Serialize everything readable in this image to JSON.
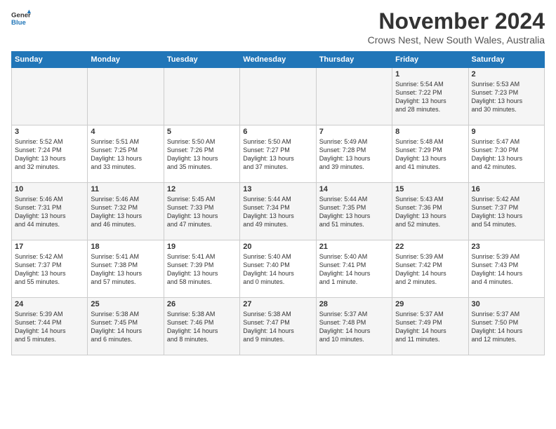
{
  "header": {
    "logo": {
      "general": "General",
      "blue": "Blue"
    },
    "title": "November 2024",
    "subtitle": "Crows Nest, New South Wales, Australia"
  },
  "weekdays": [
    "Sunday",
    "Monday",
    "Tuesday",
    "Wednesday",
    "Thursday",
    "Friday",
    "Saturday"
  ],
  "weeks": [
    [
      {
        "day": "",
        "detail": ""
      },
      {
        "day": "",
        "detail": ""
      },
      {
        "day": "",
        "detail": ""
      },
      {
        "day": "",
        "detail": ""
      },
      {
        "day": "",
        "detail": ""
      },
      {
        "day": "1",
        "detail": "Sunrise: 5:54 AM\nSunset: 7:22 PM\nDaylight: 13 hours\nand 28 minutes."
      },
      {
        "day": "2",
        "detail": "Sunrise: 5:53 AM\nSunset: 7:23 PM\nDaylight: 13 hours\nand 30 minutes."
      }
    ],
    [
      {
        "day": "3",
        "detail": "Sunrise: 5:52 AM\nSunset: 7:24 PM\nDaylight: 13 hours\nand 32 minutes."
      },
      {
        "day": "4",
        "detail": "Sunrise: 5:51 AM\nSunset: 7:25 PM\nDaylight: 13 hours\nand 33 minutes."
      },
      {
        "day": "5",
        "detail": "Sunrise: 5:50 AM\nSunset: 7:26 PM\nDaylight: 13 hours\nand 35 minutes."
      },
      {
        "day": "6",
        "detail": "Sunrise: 5:50 AM\nSunset: 7:27 PM\nDaylight: 13 hours\nand 37 minutes."
      },
      {
        "day": "7",
        "detail": "Sunrise: 5:49 AM\nSunset: 7:28 PM\nDaylight: 13 hours\nand 39 minutes."
      },
      {
        "day": "8",
        "detail": "Sunrise: 5:48 AM\nSunset: 7:29 PM\nDaylight: 13 hours\nand 41 minutes."
      },
      {
        "day": "9",
        "detail": "Sunrise: 5:47 AM\nSunset: 7:30 PM\nDaylight: 13 hours\nand 42 minutes."
      }
    ],
    [
      {
        "day": "10",
        "detail": "Sunrise: 5:46 AM\nSunset: 7:31 PM\nDaylight: 13 hours\nand 44 minutes."
      },
      {
        "day": "11",
        "detail": "Sunrise: 5:46 AM\nSunset: 7:32 PM\nDaylight: 13 hours\nand 46 minutes."
      },
      {
        "day": "12",
        "detail": "Sunrise: 5:45 AM\nSunset: 7:33 PM\nDaylight: 13 hours\nand 47 minutes."
      },
      {
        "day": "13",
        "detail": "Sunrise: 5:44 AM\nSunset: 7:34 PM\nDaylight: 13 hours\nand 49 minutes."
      },
      {
        "day": "14",
        "detail": "Sunrise: 5:44 AM\nSunset: 7:35 PM\nDaylight: 13 hours\nand 51 minutes."
      },
      {
        "day": "15",
        "detail": "Sunrise: 5:43 AM\nSunset: 7:36 PM\nDaylight: 13 hours\nand 52 minutes."
      },
      {
        "day": "16",
        "detail": "Sunrise: 5:42 AM\nSunset: 7:37 PM\nDaylight: 13 hours\nand 54 minutes."
      }
    ],
    [
      {
        "day": "17",
        "detail": "Sunrise: 5:42 AM\nSunset: 7:37 PM\nDaylight: 13 hours\nand 55 minutes."
      },
      {
        "day": "18",
        "detail": "Sunrise: 5:41 AM\nSunset: 7:38 PM\nDaylight: 13 hours\nand 57 minutes."
      },
      {
        "day": "19",
        "detail": "Sunrise: 5:41 AM\nSunset: 7:39 PM\nDaylight: 13 hours\nand 58 minutes."
      },
      {
        "day": "20",
        "detail": "Sunrise: 5:40 AM\nSunset: 7:40 PM\nDaylight: 14 hours\nand 0 minutes."
      },
      {
        "day": "21",
        "detail": "Sunrise: 5:40 AM\nSunset: 7:41 PM\nDaylight: 14 hours\nand 1 minute."
      },
      {
        "day": "22",
        "detail": "Sunrise: 5:39 AM\nSunset: 7:42 PM\nDaylight: 14 hours\nand 2 minutes."
      },
      {
        "day": "23",
        "detail": "Sunrise: 5:39 AM\nSunset: 7:43 PM\nDaylight: 14 hours\nand 4 minutes."
      }
    ],
    [
      {
        "day": "24",
        "detail": "Sunrise: 5:39 AM\nSunset: 7:44 PM\nDaylight: 14 hours\nand 5 minutes."
      },
      {
        "day": "25",
        "detail": "Sunrise: 5:38 AM\nSunset: 7:45 PM\nDaylight: 14 hours\nand 6 minutes."
      },
      {
        "day": "26",
        "detail": "Sunrise: 5:38 AM\nSunset: 7:46 PM\nDaylight: 14 hours\nand 8 minutes."
      },
      {
        "day": "27",
        "detail": "Sunrise: 5:38 AM\nSunset: 7:47 PM\nDaylight: 14 hours\nand 9 minutes."
      },
      {
        "day": "28",
        "detail": "Sunrise: 5:37 AM\nSunset: 7:48 PM\nDaylight: 14 hours\nand 10 minutes."
      },
      {
        "day": "29",
        "detail": "Sunrise: 5:37 AM\nSunset: 7:49 PM\nDaylight: 14 hours\nand 11 minutes."
      },
      {
        "day": "30",
        "detail": "Sunrise: 5:37 AM\nSunset: 7:50 PM\nDaylight: 14 hours\nand 12 minutes."
      }
    ]
  ]
}
